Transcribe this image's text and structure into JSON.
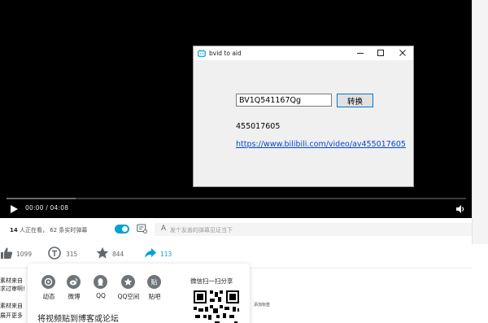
{
  "player": {
    "time_current": "00:00",
    "time_sep": "/",
    "time_total": "04:08",
    "progress_buffered": 0.15
  },
  "dialog": {
    "title": "bvid to aid",
    "input_value": "BV1Q541167Qg",
    "convert_label": "转换",
    "aid": "455017605",
    "link": "https://www.bilibili.com/video/av455017605"
  },
  "status": {
    "viewers_count": "14",
    "viewers_text": "人正在看，",
    "danmaku_count": "62",
    "danmaku_text": "条实时弹幕",
    "danmaku_a": "A",
    "danmaku_placeholder": "发个友善的弹幕见证当下"
  },
  "actions": {
    "like": "1099",
    "coin": "315",
    "fav": "844",
    "share": "113"
  },
  "description": {
    "line1": "素材来自",
    "line2": "求过审啊!",
    "line3": "素材来自",
    "more": "展开更多",
    "tag": "添加标签"
  },
  "share_popup": {
    "items": [
      "动态",
      "微博",
      "QQ",
      "QQ空间",
      "贴吧"
    ],
    "embed_title": "将视频贴到博客或论坛",
    "wechat_label": "微信扫一扫分享"
  },
  "colors": {
    "accent": "#00a1d6",
    "link": "#0645d6",
    "icon_gray": "#6d757a"
  }
}
